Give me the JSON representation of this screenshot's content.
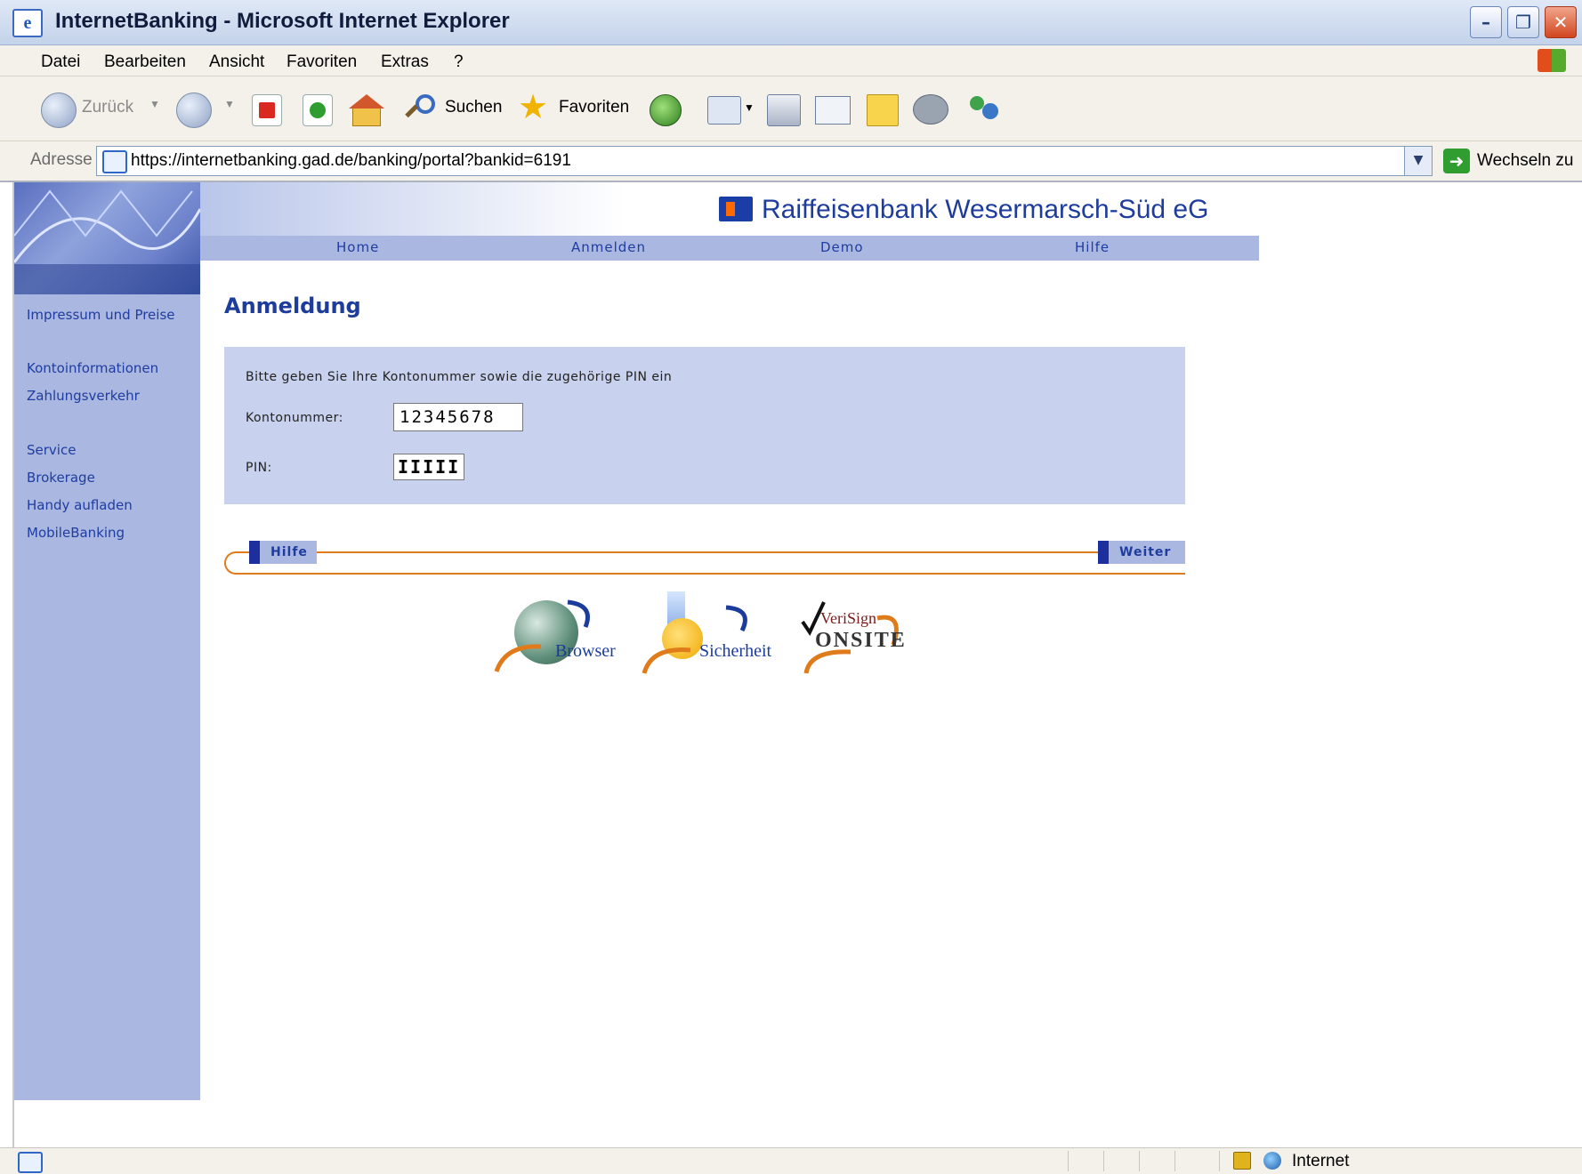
{
  "window": {
    "title": "InternetBanking - Microsoft Internet Explorer"
  },
  "menu": {
    "items": [
      {
        "label": "Datei"
      },
      {
        "label": "Bearbeiten"
      },
      {
        "label": "Ansicht"
      },
      {
        "label": "Favoriten"
      },
      {
        "label": "Extras"
      },
      {
        "label": "?"
      }
    ]
  },
  "toolbar": {
    "back_label": "Zurück",
    "search_label": "Suchen",
    "favorites_label": "Favoriten"
  },
  "address": {
    "label": "Adresse",
    "url": "https://internetbanking.gad.de/banking/portal?bankid=6191",
    "go_label": "Wechseln zu"
  },
  "bank": {
    "name": "Raiffeisenbank Wesermarsch-Süd eG"
  },
  "topnav": {
    "items": [
      {
        "label": "Home"
      },
      {
        "label": "Anmelden"
      },
      {
        "label": "Demo"
      },
      {
        "label": "Hilfe"
      }
    ]
  },
  "sidebar": {
    "items": [
      {
        "label": "Impressum und Preise"
      },
      {
        "label": "Kontoinformationen"
      },
      {
        "label": "Zahlungsverkehr"
      },
      {
        "label": "Service"
      },
      {
        "label": "Brokerage"
      },
      {
        "label": "Handy aufladen"
      },
      {
        "label": "MobileBanking"
      }
    ]
  },
  "login": {
    "title": "Anmeldung",
    "instruction": "Bitte geben Sie Ihre Kontonummer sowie die zugehörige PIN ein",
    "account_label": "Kontonummer:",
    "account_value": "12345678",
    "pin_label": "PIN:",
    "pin_value": "IIIII",
    "help_button": "Hilfe",
    "next_button": "Weiter"
  },
  "logos": {
    "browser": "Browser",
    "security": "Sicherheit",
    "verisign": "VeriSign",
    "onsite": "ONSITE"
  },
  "status": {
    "zone": "Internet"
  },
  "colors": {
    "brand_blue": "#1e3c9c",
    "nav_bg": "#aab7e1",
    "form_bg": "#c8d1ed",
    "accent_orange": "#e07b1c"
  }
}
